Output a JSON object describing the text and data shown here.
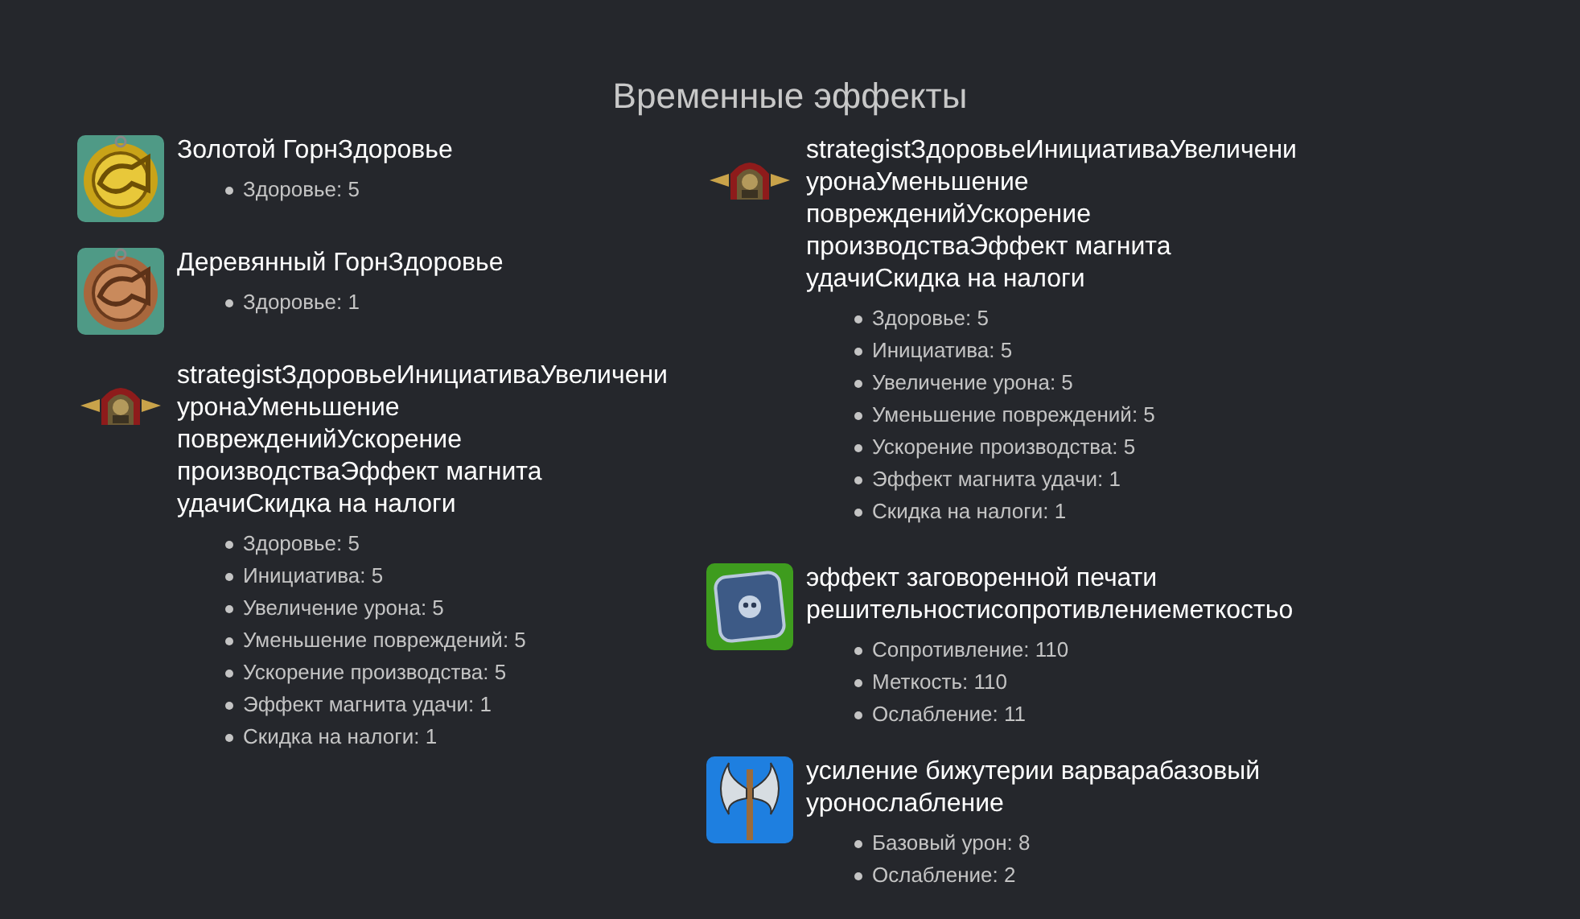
{
  "heading": "Временные эффекты",
  "columns": [
    {
      "effects": [
        {
          "kind": "gold_horn",
          "title": "Золотой ГорнЗдоровье",
          "stats": [
            "Здоровье: 5"
          ]
        },
        {
          "kind": "bronze_horn",
          "title": "Деревянный ГорнЗдоровье",
          "stats": [
            "Здоровье: 1"
          ]
        },
        {
          "kind": "helmet",
          "title": "strategistЗдоровьеИнициативаУвеличени\nуронаУменьшение\nповрежденийУскорение\nпроизводстваЭффект магнита\nудачиСкидка на налоги",
          "stats": [
            "Здоровье: 5",
            "Инициатива: 5",
            "Увеличение урона: 5",
            "Уменьшение повреждений: 5",
            "Ускорение производства: 5",
            "Эффект магнита удачи: 1",
            "Скидка на налоги: 1"
          ]
        }
      ]
    },
    {
      "effects": [
        {
          "kind": "helmet",
          "title": "strategistЗдоровьеИнициативаУвеличени\nуронаУменьшение\nповрежденийУскорение\nпроизводстваЭффект магнита\nудачиСкидка на налоги",
          "stats": [
            "Здоровье: 5",
            "Инициатива: 5",
            "Увеличение урона: 5",
            "Уменьшение повреждений: 5",
            "Ускорение производства: 5",
            "Эффект магнита удачи: 1",
            "Скидка на налоги: 1"
          ]
        },
        {
          "kind": "seal",
          "title": "эффект заговоренной печати\nрешительностисопротивлениеметкостьо",
          "stats": [
            "Сопротивление: 110",
            "Меткость: 110",
            "Ослабление: 11"
          ]
        },
        {
          "kind": "axe",
          "title": "усиление бижутерии варварабазовый\nуронослабление",
          "stats": [
            "Базовый урон: 8",
            "Ослабление: 2"
          ]
        }
      ]
    }
  ]
}
